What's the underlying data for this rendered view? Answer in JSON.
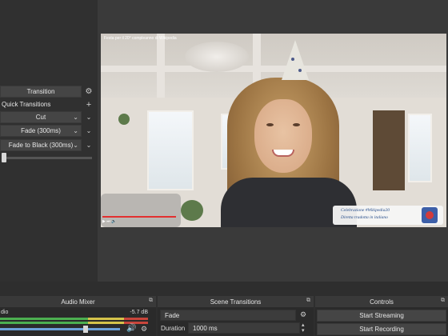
{
  "left_dock": {
    "transition_button": "Transition",
    "quick_transitions_label": "Quick Transitions",
    "add_icon": "plus-icon",
    "items": [
      {
        "label": "Cut"
      },
      {
        "label": "Fade (300ms)"
      },
      {
        "label": "Fade to Black (300ms)"
      }
    ]
  },
  "preview": {
    "video_title": "Festa per il 20° compleanno di Wikipedia",
    "lower_third_line1": "Celebrazione #Wikipedia20",
    "lower_third_line2": "Diretta tradotta in italiano",
    "player_controls": "▶ ⏭ 🔊"
  },
  "audio_mixer": {
    "title": "Audio Mixer",
    "source_label": "dio",
    "level_db": "-5.7 dB",
    "accent_green": "#4caf50",
    "accent_yellow": "#d4c34a",
    "accent_red": "#c8453b"
  },
  "scene_transitions": {
    "title": "Scene Transitions",
    "selected_transition": "Fade",
    "duration_label": "Duration",
    "duration_value": "1000 ms"
  },
  "controls": {
    "title": "Controls",
    "start_streaming": "Start Streaming",
    "start_recording": "Start Recording"
  }
}
